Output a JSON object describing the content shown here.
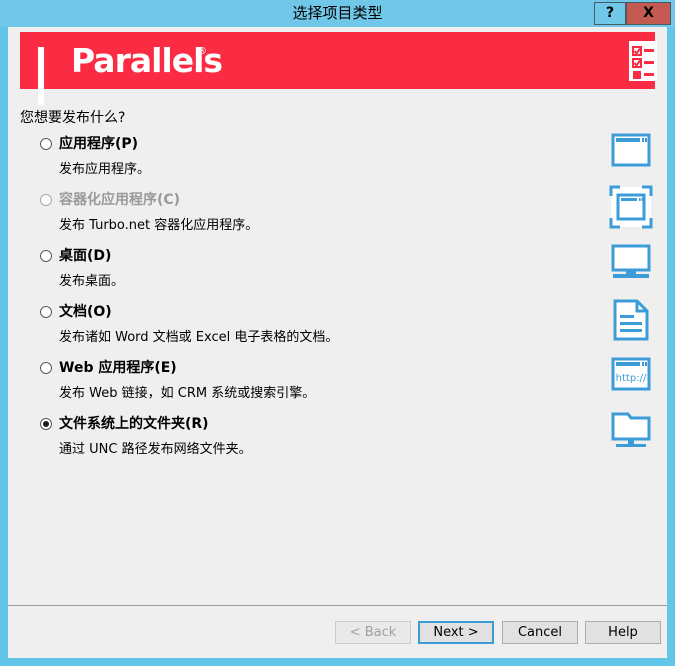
{
  "window": {
    "title": "选择项目类型",
    "help_button": "?",
    "close_button": "X",
    "accent_blue": "#71c7e8",
    "brand_red": "#fa2b43",
    "close_red": "#c45b52",
    "icon_blue": "#3c9cd8",
    "panel_bg": "#efefef"
  },
  "brand": {
    "name": "Parallels",
    "trademark": "®",
    "header_icon": "checklist-icon"
  },
  "content": {
    "question": "您想要发布什么?",
    "options": [
      {
        "label": "应用程序(P)",
        "description": "发布应用程序。",
        "selected": false,
        "disabled": false,
        "icon": "application-window-icon"
      },
      {
        "label": "容器化应用程序(C)",
        "description": "发布 Turbo.net 容器化应用程序。",
        "selected": false,
        "disabled": true,
        "icon": "containerized-application-icon"
      },
      {
        "label": "桌面(D)",
        "description": "发布桌面。",
        "selected": false,
        "disabled": false,
        "icon": "desktop-monitor-icon"
      },
      {
        "label": "文档(O)",
        "description": "发布诸如 Word 文档或 Excel 电子表格的文档。",
        "selected": false,
        "disabled": false,
        "icon": "document-icon"
      },
      {
        "label": "Web 应用程序(E)",
        "description": "发布 Web 链接，如 CRM 系统或搜索引擎。",
        "selected": false,
        "disabled": false,
        "icon": "web-browser-icon",
        "icon_text": "http://"
      },
      {
        "label": "文件系统上的文件夹(R)",
        "description": "通过 UNC 路径发布网络文件夹。",
        "selected": true,
        "disabled": false,
        "icon": "network-folder-icon"
      }
    ]
  },
  "footer": {
    "back": "< Back",
    "next": "Next >",
    "cancel": "Cancel",
    "help": "Help",
    "back_disabled": true,
    "next_focused": true
  }
}
